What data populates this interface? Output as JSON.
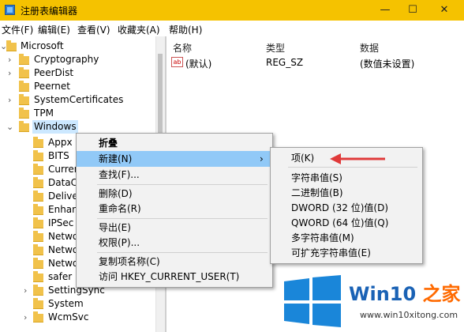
{
  "window": {
    "title": "注册表编辑器",
    "minimize": "—",
    "maximize": "☐",
    "close": "✕"
  },
  "menu": [
    "文件(F)",
    "编辑(E)",
    "查看(V)",
    "收藏夹(A)",
    "帮助(H)"
  ],
  "tree": {
    "items": [
      {
        "label": "Microsoft",
        "expander": "chevron-down"
      },
      {
        "label": "Cryptography",
        "expander": "chevron-right"
      },
      {
        "label": "PeerDist",
        "expander": "chevron-right"
      },
      {
        "label": "Peernet",
        "expander": "none"
      },
      {
        "label": "SystemCertificates",
        "expander": "chevron-right"
      },
      {
        "label": "TPM",
        "expander": "none"
      },
      {
        "label": "Windows",
        "expander": "chevron-down",
        "selected": true
      },
      {
        "label": "Appx",
        "expander": "none"
      },
      {
        "label": "BITS",
        "expander": "none"
      },
      {
        "label": "Curren",
        "expander": "none"
      },
      {
        "label": "DataC",
        "expander": "none"
      },
      {
        "label": "Delive",
        "expander": "none"
      },
      {
        "label": "Enhan",
        "expander": "none"
      },
      {
        "label": "IPSec",
        "expander": "none"
      },
      {
        "label": "Netwo",
        "expander": "none"
      },
      {
        "label": "Netwo",
        "expander": "none"
      },
      {
        "label": "Netwo",
        "expander": "none"
      },
      {
        "label": "safer",
        "expander": "none"
      },
      {
        "label": "SettingSync",
        "expander": "chevron-right"
      },
      {
        "label": "System",
        "expander": "none"
      },
      {
        "label": "WcmSvc",
        "expander": "chevron-right"
      }
    ]
  },
  "list": {
    "headers": {
      "name": "名称",
      "type": "类型",
      "data": "数据"
    },
    "rows": [
      {
        "icon": "ab",
        "name": "(默认)",
        "type": "REG_SZ",
        "data": "(数值未设置)"
      }
    ]
  },
  "context_menu": {
    "items": [
      "折叠",
      "新建(N)",
      "查找(F)...",
      "删除(D)",
      "重命名(R)",
      "导出(E)",
      "权限(P)...",
      "复制项名称(C)",
      "访问 HKEY_CURRENT_USER(T)"
    ],
    "submenu_arrow": "›"
  },
  "submenu": {
    "items": [
      "项(K)",
      "字符串值(S)",
      "二进制值(B)",
      "DWORD (32 位)值(D)",
      "QWORD (64 位)值(Q)",
      "多字符串值(M)",
      "可扩充字符串值(E)"
    ]
  },
  "watermark": {
    "brand": "Win10",
    "brand_accent": " 之家",
    "url": "www.win10xitong.com"
  },
  "colors": {
    "titlebar": "#f5c200",
    "selection": "#cce8ff",
    "menu_highlight": "#91c9f7",
    "arrow": "#e03a3a",
    "logo_blue": "#1a62b5"
  }
}
